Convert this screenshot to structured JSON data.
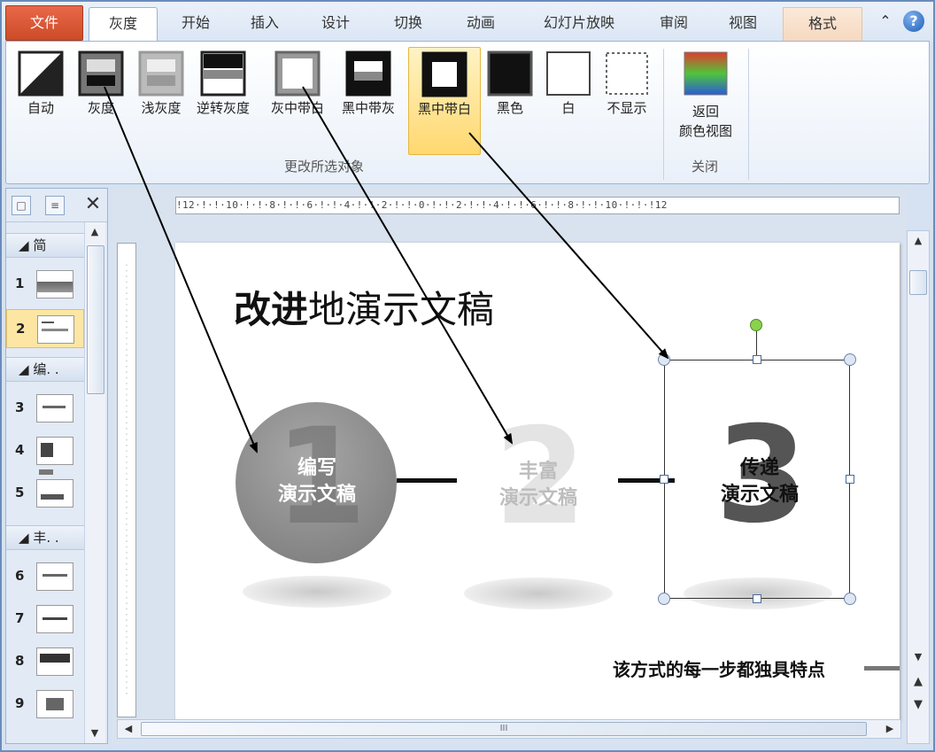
{
  "tabs": {
    "file": "文件",
    "grayscale": "灰度",
    "home": "开始",
    "insert": "插入",
    "design": "设计",
    "transitions": "切换",
    "animations": "动画",
    "slideshow": "幻灯片放映",
    "review": "审阅",
    "view": "视图",
    "format": "格式"
  },
  "ribbon": {
    "buttons": [
      {
        "label": "自动"
      },
      {
        "label": "灰度"
      },
      {
        "label": "浅灰度"
      },
      {
        "label": "逆转灰度"
      },
      {
        "label": "灰中带白"
      },
      {
        "label": "黑中带灰"
      },
      {
        "label": "黑中带白"
      },
      {
        "label": "黑色"
      },
      {
        "label": "白"
      },
      {
        "label": "不显示"
      }
    ],
    "group_label": "更改所选对象",
    "return_label_1": "返回",
    "return_label_2": "颜色视图",
    "close_group_label": "关闭"
  },
  "left_panel": {
    "sections": [
      "简",
      "编. .",
      "丰. ."
    ],
    "slides": [
      "1",
      "2",
      "3",
      "4",
      "5",
      "6",
      "7",
      "8",
      "9"
    ]
  },
  "ruler": {
    "horizontal": "!12·!·!·10·!·!·8·!·!·6·!·!·4·!·!·2·!·!·0·!·!·2·!·!·4·!·!·6·!·!·8·!·!·10·!·!·!12"
  },
  "slide": {
    "title_bold": "改进",
    "title_rest": "地演示文稿",
    "step1": {
      "number": "1",
      "line1": "编写",
      "line2": "演示文稿"
    },
    "step2": {
      "number": "2",
      "line1": "丰富",
      "line2": "演示文稿"
    },
    "step3": {
      "number": "3",
      "line1": "传递",
      "line2": "演示文稿"
    },
    "footer": "该方式的每一步都独具特点"
  },
  "scrollbar": {
    "grip": "III"
  }
}
